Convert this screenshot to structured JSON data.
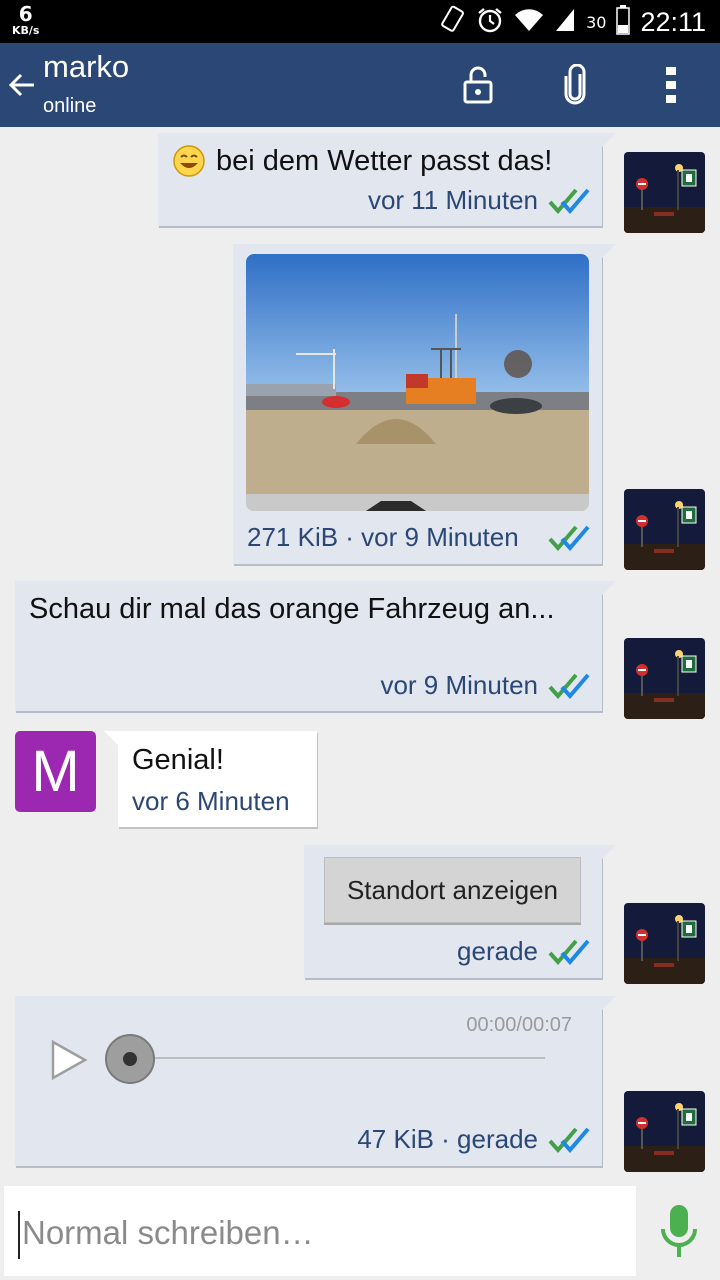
{
  "status_bar": {
    "speed_value": "6",
    "speed_unit": "KB/s",
    "battery": "30",
    "time": "22:11"
  },
  "app_bar": {
    "title": "marko",
    "subtitle": "online"
  },
  "messages": [
    {
      "text": "bei dem Wetter passt das!",
      "meta": "vor 11 Minuten"
    },
    {
      "meta": "271 KiB · vor 9 Minuten"
    },
    {
      "text": "Schau dir mal das orange Fahrzeug an...",
      "meta": "vor 9 Minuten"
    },
    {
      "avatar_letter": "M",
      "text": "Genial!",
      "meta": "vor 6 Minuten"
    },
    {
      "button": "Standort anzeigen",
      "meta": "gerade"
    },
    {
      "duration": "00:00/00:07",
      "meta": "47 KiB · gerade"
    }
  ],
  "input": {
    "placeholder": "Normal schreiben…"
  },
  "colors": {
    "appbar": "#2b4775",
    "bubble_out": "#e2e6ef",
    "avatar_m": "#9c27b0",
    "mic": "#4caf50"
  }
}
